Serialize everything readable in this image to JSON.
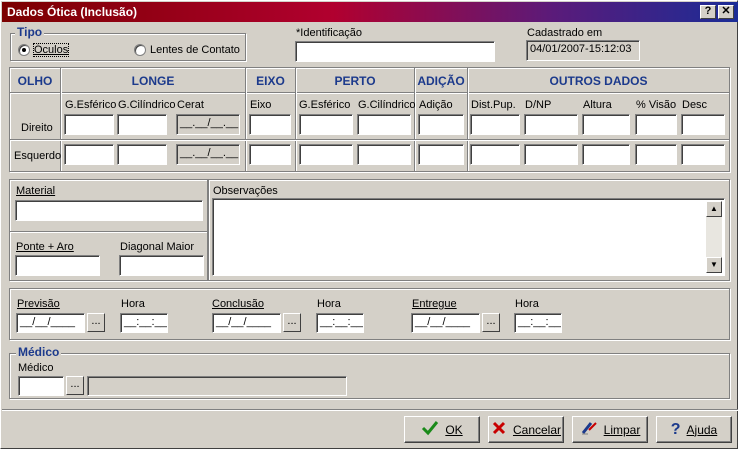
{
  "window": {
    "title": "Dados Ótica (Inclusão)",
    "help_label": "?",
    "close_label": "✕"
  },
  "tipo": {
    "legend": "Tipo",
    "opt1": "Óculos",
    "opt2": "Lentes de Contato",
    "selected": "Óculos"
  },
  "identificacao": {
    "label": "*Identificação",
    "value": ""
  },
  "cadastro": {
    "label": "Cadastrado em",
    "value": "04/01/2007-15:12:03"
  },
  "grid": {
    "headers": {
      "olho": "OLHO",
      "longe": "LONGE",
      "eixo": "EIXO",
      "perto": "PERTO",
      "adicao": "ADIÇÃO",
      "outros": "OUTROS DADOS"
    },
    "subheaders": {
      "g_esferico": "G.Esférico",
      "g_cilindrico": "G.Cilíndrico",
      "cerat": "Cerat",
      "eixo": "Eixo",
      "perto_esf": "G.Esférico",
      "perto_cil": "G.Cilíndrico",
      "adicao": "Adição",
      "dist_pup": "Dist.Pup.",
      "dnp": "D/NP",
      "altura": "Altura",
      "visao": "% Visão",
      "desc": "Desc"
    },
    "rows": {
      "direito": "Direito",
      "esquerdo": "Esquerdo"
    },
    "cerat_mask": "__.__/__.__"
  },
  "material": {
    "label": "Material",
    "value": ""
  },
  "ponte": {
    "label": "Ponte + Aro",
    "value": ""
  },
  "diagonal": {
    "label": "Diagonal Maior",
    "value": ""
  },
  "observacoes": {
    "label": "Observações",
    "value": ""
  },
  "datas": {
    "previsao": "Previsão",
    "conclusao": "Conclusão",
    "entregue": "Entregue",
    "hora": "Hora",
    "date_mask": "__/__/____",
    "time_mask": "__:__:__",
    "dots": "..."
  },
  "medico": {
    "legend": "Médico",
    "label": "Médico",
    "code": "",
    "name": ""
  },
  "buttons": {
    "ok": "OK",
    "cancelar": "Cancelar",
    "limpar": "Limpar",
    "ajuda": "Ajuda"
  },
  "colors": {
    "accent": "#1c3a8c",
    "face": "#d4d0c8",
    "title_start": "#7b0000",
    "title_end": "#1b2c96"
  }
}
